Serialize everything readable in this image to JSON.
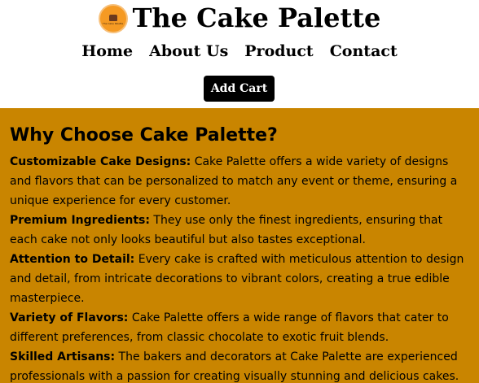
{
  "brand": {
    "title": "The Cake Palette",
    "logo_text": "The Cake Palette"
  },
  "nav": {
    "items": [
      {
        "label": "Home"
      },
      {
        "label": "About Us"
      },
      {
        "label": "Product"
      },
      {
        "label": "Contact"
      }
    ]
  },
  "header": {
    "add_cart_label": "Add Cart"
  },
  "why": {
    "heading": "Why Choose Cake Palette?",
    "features": [
      {
        "name": "Customizable Cake Designs:",
        "text": " Cake Palette offers a wide variety of designs and flavors that can be personalized to match any event or theme, ensuring a unique experience for every customer."
      },
      {
        "name": "Premium Ingredients:",
        "text": " They use only the finest ingredients, ensuring that each cake not only looks beautiful but also tastes exceptional."
      },
      {
        "name": "Attention to Detail:",
        "text": " Every cake is crafted with meticulous attention to design and detail, from intricate decorations to vibrant colors, creating a true edible masterpiece."
      },
      {
        "name": "Variety of Flavors:",
        "text": " Cake Palette offers a wide range of flavors that cater to different preferences, from classic chocolate to exotic fruit blends."
      },
      {
        "name": "Skilled Artisans:",
        "text": " The bakers and decorators at Cake Palette are experienced professionals with a passion for creating visually stunning and delicious cakes."
      }
    ]
  },
  "colors": {
    "section_bg": "#c98500",
    "logo_bg": "#f59a23",
    "button_bg": "#000000"
  },
  "icons": {
    "logo": "cake-logo-icon"
  }
}
